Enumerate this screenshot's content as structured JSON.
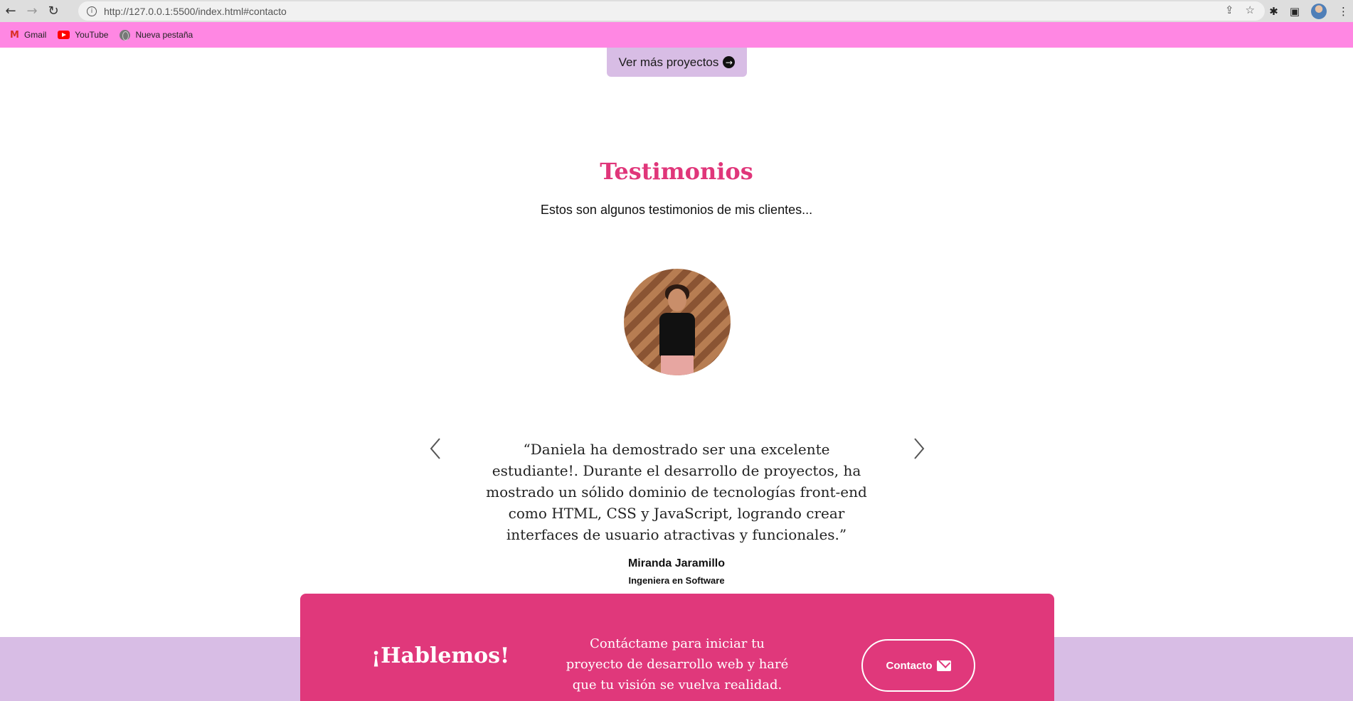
{
  "browser": {
    "url": "http://127.0.0.1:5500/index.html#contacto",
    "bookmarks": [
      {
        "label": "Gmail"
      },
      {
        "label": "YouTube"
      },
      {
        "label": "Nueva pestaña"
      }
    ]
  },
  "projects": {
    "more_button_label": "Ver más proyectos"
  },
  "testimonials": {
    "title": "Testimonios",
    "subtitle": "Estos son algunos testimonios de mis clientes...",
    "quote": "“Daniela ha demostrado ser una excelente estudiante!. Durante el desarrollo de proyectos, ha mostrado un sólido dominio de tecnologías front-end como HTML, CSS y JavaScript, logrando crear interfaces de usuario atractivas y funcionales.”",
    "author_name": "Miranda Jaramillo",
    "author_role": "Ingeniera en Software"
  },
  "contact": {
    "title": "¡Hablemos!",
    "text": "Contáctame para iniciar tu proyecto de desarrollo web y haré que tu visión se vuelva realidad.",
    "button_label": "Contacto"
  },
  "colors": {
    "bookmark_bar": "#ff87e3",
    "accent_pink": "#e0387b",
    "lavender": "#d8bde5"
  }
}
